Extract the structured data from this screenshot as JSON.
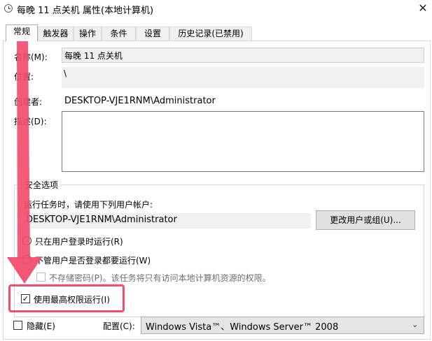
{
  "window": {
    "title": "每晚 11 点关机 属性(本地计算机)",
    "close_glyph": "✕"
  },
  "tabs": [
    {
      "label": "常规",
      "active": true
    },
    {
      "label": "触发器",
      "active": false
    },
    {
      "label": "操作",
      "active": false
    },
    {
      "label": "条件",
      "active": false
    },
    {
      "label": "设置",
      "active": false
    },
    {
      "label": "历史记录(已禁用)",
      "active": false
    }
  ],
  "general": {
    "name_label": "名称(M):",
    "name_value": "每晚 11 点关机",
    "location_label": "位置:",
    "location_value": "\\",
    "author_label": "创建者:",
    "author_value": "DESKTOP-VJE1RNM\\Administrator",
    "description_label": "描述(D):",
    "description_value": ""
  },
  "security": {
    "group_title": "安全选项",
    "run_as_text": "运行任务时，请使用下列用户帐户:",
    "account_value": "DESKTOP-VJE1RNM\\Administrator",
    "change_user_button": "更改用户或组(U)...",
    "radio_logged_on": "只在用户登录时运行(R)",
    "radio_whether": "不管用户是否登录都要运行(W)",
    "no_store_password": "不存储密码(P)。该任务将只有访问本地计算机资源的权限。",
    "highest_privileges": "使用最高权限运行(I)",
    "highest_privileges_checked": true
  },
  "footer": {
    "hidden_label": "隐藏(E)",
    "hidden_checked": false,
    "configure_label": "配置(C):",
    "configure_value": "Windows Vista™、Windows Server™ 2008",
    "dropdown_arrow": "⌄"
  },
  "colors": {
    "annotation_red": "#f14e6e",
    "field_bg": "#f0f0f0",
    "button_bg": "#e1e1e1"
  }
}
